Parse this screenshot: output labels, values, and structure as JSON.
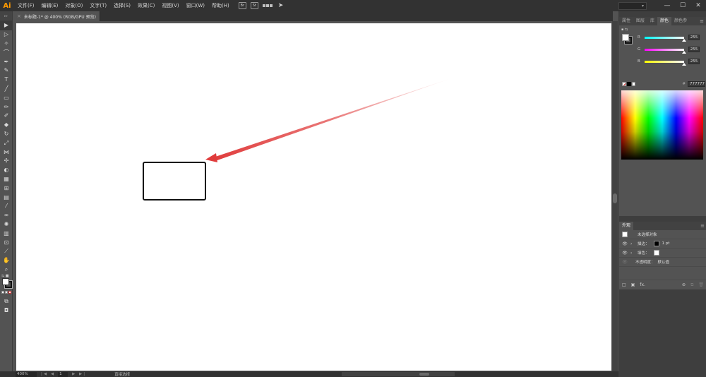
{
  "app": {
    "logo": "Ai"
  },
  "menu": [
    "文件(F)",
    "编辑(E)",
    "对象(O)",
    "文字(T)",
    "选择(S)",
    "效果(C)",
    "视图(V)",
    "窗口(W)",
    "帮助(H)"
  ],
  "menu_icons": {
    "bridge": "Br",
    "stock": "St"
  },
  "window_controls": {
    "minimize": "—",
    "maximize": "☐",
    "close": "✕"
  },
  "document_tab": {
    "close": "×",
    "title": "未标题-1* @ 400% (RGB/GPU 预览)"
  },
  "tools": [
    {
      "name": "selection-tool",
      "glyph": "▶"
    },
    {
      "name": "direct-selection-tool",
      "glyph": "▷"
    },
    {
      "name": "magic-wand-tool",
      "glyph": "✧"
    },
    {
      "name": "lasso-tool",
      "glyph": "⌒"
    },
    {
      "name": "pen-tool",
      "glyph": "✒"
    },
    {
      "name": "curvature-tool",
      "glyph": "✎"
    },
    {
      "name": "type-tool",
      "glyph": "T"
    },
    {
      "name": "line-tool",
      "glyph": "╱"
    },
    {
      "name": "rectangle-tool",
      "glyph": "▭"
    },
    {
      "name": "paintbrush-tool",
      "glyph": "✏"
    },
    {
      "name": "shaper-tool",
      "glyph": "✐"
    },
    {
      "name": "eraser-tool",
      "glyph": "◆"
    },
    {
      "name": "rotate-tool",
      "glyph": "↻"
    },
    {
      "name": "scale-tool",
      "glyph": "⤢"
    },
    {
      "name": "width-tool",
      "glyph": "⋈"
    },
    {
      "name": "puppet-warp-tool",
      "glyph": "✣"
    },
    {
      "name": "shape-builder-tool",
      "glyph": "◐"
    },
    {
      "name": "perspective-grid-tool",
      "glyph": "▦"
    },
    {
      "name": "mesh-tool",
      "glyph": "⊞"
    },
    {
      "name": "gradient-tool",
      "glyph": "▤"
    },
    {
      "name": "eyedropper-tool",
      "glyph": "⁄"
    },
    {
      "name": "blend-tool",
      "glyph": "∞"
    },
    {
      "name": "symbol-sprayer-tool",
      "glyph": "✺"
    },
    {
      "name": "column-graph-tool",
      "glyph": "▥"
    },
    {
      "name": "artboard-tool",
      "glyph": "⊡"
    },
    {
      "name": "slice-tool",
      "glyph": "⟋"
    },
    {
      "name": "hand-tool",
      "glyph": "✋"
    },
    {
      "name": "zoom-tool",
      "glyph": "⌕"
    }
  ],
  "toolbar_extras": {
    "grip": "▸▸",
    "screen_mode": "◘",
    "draw_mode": "⧉",
    "swap_colors": "⇆ ■"
  },
  "color_panel": {
    "tabs": [
      "属性",
      "图层",
      "库",
      "颜色",
      "颜色参"
    ],
    "active_tab": "颜色",
    "tab_menu": "≡",
    "mini_icons": "▪ ⇆",
    "channels": [
      {
        "label": "R",
        "value": "255",
        "gradient": "linear-gradient(to right,#00ffff,#ffffff)"
      },
      {
        "label": "G",
        "value": "255",
        "gradient": "linear-gradient(to right,#ff00ff,#ffffff)"
      },
      {
        "label": "B",
        "value": "255",
        "gradient": "linear-gradient(to right,#ffff00,#ffffff)"
      }
    ],
    "hex_label": "#",
    "hex_value": "777777"
  },
  "appearance_panel": {
    "tab": "外观",
    "tab_menu": "≡",
    "title_row": "未选择对象",
    "stroke_label": "描边：",
    "stroke_value": "1 pt",
    "fill_label": "填色：",
    "opacity_label": "不透明度：",
    "opacity_value": "默认值",
    "eye_glyph": "👁",
    "chevron_glyph": "›",
    "footer_icons": {
      "square": "□",
      "layer": "▣",
      "fx": "fx.",
      "clear": "⊘",
      "duplicate": "⧉",
      "delete": "🗑"
    }
  },
  "status": {
    "zoom": "400%",
    "nav_prev": "|◀ ◀",
    "page": "1",
    "nav_next": "▶ ▶|",
    "tool_name": "直接选择"
  },
  "colors": {
    "accent": "#ff9a00",
    "arrow": "#e03c3c"
  }
}
